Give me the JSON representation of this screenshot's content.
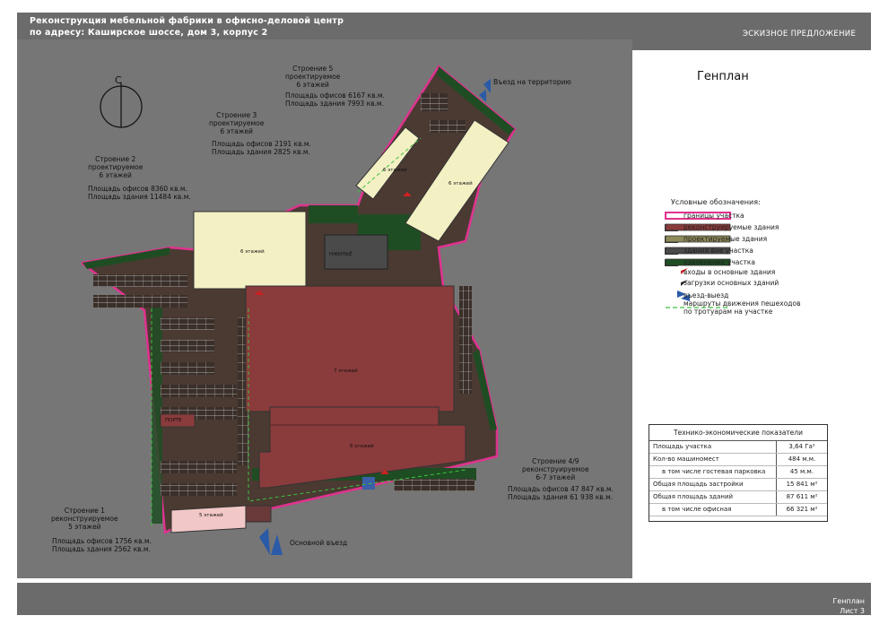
{
  "header": {
    "line1": "Реконструкция мебельной фабрики в офисно-деловой центр",
    "line2": "по адресу: Каширское шоссе, дом 3, корпус 2",
    "stage": "ЭСКИЗНОЕ ПРЕДЛОЖЕНИЕ"
  },
  "sheet_title": "Генплан",
  "footer": {
    "title": "Генплан",
    "sheet": "Лист 3"
  },
  "compass_letter": "С",
  "colors": {
    "boundary": "#e0328f",
    "reconstructed": "#8a3b3b",
    "designed": "#f3f0c4",
    "existing": "#4a4a4a",
    "green": "#1f4d23",
    "pavement": "#4a3a32",
    "background": "#767676"
  },
  "buildings": {
    "b1": {
      "title": "Строение 1",
      "status": "реконструируемое",
      "floors": "5 этажей",
      "office": "Площадь офисов    1756 кв.м.",
      "total": "Площадь здания    2562 кв.м.",
      "plan_label": "5 этажей"
    },
    "b2": {
      "title": "Строение 2",
      "status": "проектируемое",
      "floors": "6 этажей",
      "office": "Площадь офисов   8360 кв.м.",
      "total": "Площадь здания   11484 кв.м.",
      "plan_label": "6 этажей"
    },
    "b3": {
      "title": "Строение 3",
      "status": "проектируемое",
      "floors": "6 этажей",
      "office": "Площадь офисов   2191 кв.м.",
      "total": "Площадь здания   2825 кв.м.",
      "plan_label": "6 этажей"
    },
    "b5": {
      "title": "Строение 5",
      "status": "проектируемое",
      "floors": "6 этажей",
      "office": "Площадь офисов   6167 кв.м.",
      "total": "Площадь здания   7993 кв.м.",
      "plan_label": "6 этажей"
    },
    "b47": {
      "title": "Строение 4/9",
      "status": "реконструируемое",
      "floors": "6-7 этажей",
      "office": "Площадь офисов  47 847 кв.м.",
      "total": "Площадь здания  61 938 кв.м.",
      "plan_label_a": "7 этажей",
      "plan_label_b": "6 этажей"
    },
    "existing": {
      "plan_label": "НЖИЛЬЁ"
    },
    "small": {
      "plan_label": "ПОРТЕ"
    }
  },
  "labels": {
    "entry_territory": "Въезд на территорию",
    "main_entry": "Основной въезд"
  },
  "legend": {
    "title": "Условные обозначения:",
    "items": [
      "границы участка",
      "реконструируемые здания",
      "проектируемые здания",
      "здания вне участка",
      "озеленение участка",
      "входы в основные здания",
      "загрузки основных зданий",
      "въезд-выезд",
      "маршруты движения пешеходов",
      "по тротуарам на участке"
    ]
  },
  "table": {
    "title": "Технико-экономические показатели",
    "rows": [
      {
        "label": "Площадь участка",
        "value": "3,64 Га²",
        "sub": false
      },
      {
        "label": "Кол-во машиномест",
        "value": "484 м.м.",
        "sub": false
      },
      {
        "label": "в том числе гостевая парковка",
        "value": "45 м.м.",
        "sub": true
      },
      {
        "label": "Общая площадь застройки",
        "value": "15 841 м²",
        "sub": false
      },
      {
        "label": "Общая площадь зданий",
        "value": "87 611 м²",
        "sub": false
      },
      {
        "label": "в том числе офисная",
        "value": "66 321 м²",
        "sub": true
      }
    ]
  }
}
